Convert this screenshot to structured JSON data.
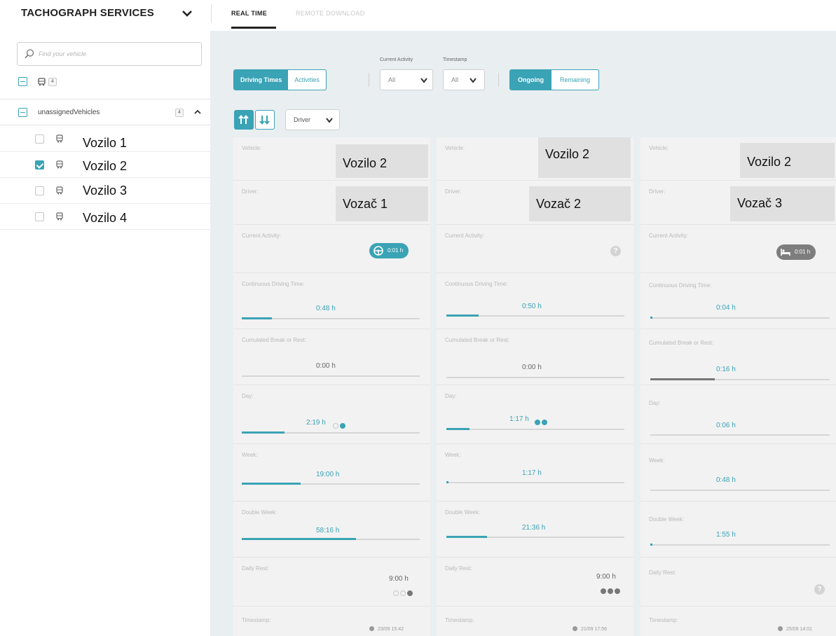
{
  "app": {
    "title": "TACHOGRAPH SERVICES"
  },
  "tabs": [
    {
      "label": "REAL TIME"
    },
    {
      "label": "REMOTE DOWNLOAD"
    }
  ],
  "sidebar": {
    "search_placeholder": "Find your vehicle",
    "top_badge": "4",
    "group": {
      "label": "unassignedVehicles",
      "badge": "4"
    },
    "vehicles": [
      {
        "name": "Vozilo 1",
        "checked": false
      },
      {
        "name": "Vozilo 2",
        "checked": true
      },
      {
        "name": "Vozilo 3",
        "checked": false
      },
      {
        "name": "Vozilo 4",
        "checked": false
      }
    ]
  },
  "toolbar": {
    "view_toggle": [
      "Driving Times",
      "Activities"
    ],
    "current_activity_label": "Current Activity",
    "current_activity_value": "All",
    "timestamp_label": "Timestamp",
    "timestamp_value": "All",
    "mode_toggle": [
      "Ongoing",
      "Remaining"
    ],
    "group_by_value": "Driver"
  },
  "labels": {
    "vehicle": "Vehicle:",
    "driver": "Driver:",
    "current_activity": "Current Activity:",
    "continuous_driving": "Continuous Driving Time:",
    "cumulated_break": "Cumulated Break or Rest:",
    "day": "Day:",
    "week": "Week:",
    "double_week": "Double Week:",
    "daily_rest": "Daily Rest:",
    "timestamp": "Timestamp:"
  },
  "cards": [
    {
      "vehicle": "Vozilo 2",
      "driver": "Vozač 1",
      "activity": {
        "kind": "driving",
        "value": "0:01 h"
      },
      "continuous_driving": {
        "value": "0:48 h",
        "progress": 0.17
      },
      "cumulated_break": {
        "value": "0:00 h",
        "progress": 0.0
      },
      "day": {
        "value": "2:19 h",
        "progress": 0.24
      },
      "week": {
        "value": "19:00 h",
        "progress": 0.33
      },
      "double_week": {
        "value": "58:16 h",
        "progress": 0.64
      },
      "daily_rest": {
        "value": "9:00 h"
      },
      "timestamp": "23/09 15:42"
    },
    {
      "vehicle": "Vozilo 2",
      "driver": "Vozač 2",
      "activity": {
        "kind": "unknown",
        "value": ""
      },
      "continuous_driving": {
        "value": "0:50 h",
        "progress": 0.18
      },
      "cumulated_break": {
        "value": "0:00 h",
        "progress": 0.0
      },
      "day": {
        "value": "1:17 h",
        "progress": 0.13
      },
      "week": {
        "value": "1:17 h",
        "progress": 0.01
      },
      "double_week": {
        "value": "21:36 h",
        "progress": 0.23
      },
      "daily_rest": {
        "value": "9:00 h"
      },
      "timestamp": "21/09 17:56"
    },
    {
      "vehicle": "Vozilo 2",
      "driver": "Vozač 3",
      "activity": {
        "kind": "resting",
        "value": "0:01 h"
      },
      "continuous_driving": {
        "value": "0:04 h",
        "progress": 0.01
      },
      "cumulated_break": {
        "value": "0:16 h",
        "progress": 0.36
      },
      "day": {
        "value": "0:06 h",
        "progress": 0.0
      },
      "week": {
        "value": "0:48 h",
        "progress": 0.0
      },
      "double_week": {
        "value": "1:55 h",
        "progress": 0.01
      },
      "daily_rest": {
        "value": ""
      },
      "timestamp": "25/09 14:01"
    }
  ],
  "colors": {
    "accent": "#3aa3b5",
    "background": "#e9eef1",
    "card": "#f2f2f2"
  }
}
